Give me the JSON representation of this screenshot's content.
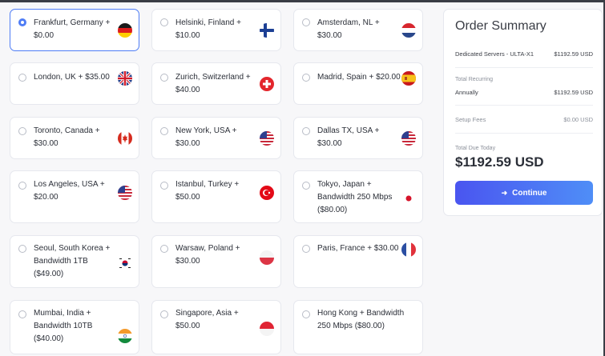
{
  "locations": [
    {
      "label": "Frankfurt, Germany +\n$0.00",
      "flag": "germany-flag-icon",
      "selected": true
    },
    {
      "label": "Helsinki, Finland +\n$10.00",
      "flag": "finland-flag-icon",
      "selected": false
    },
    {
      "label": "Amsterdam, NL +\n$30.00",
      "flag": "netherlands-flag-icon",
      "selected": false
    },
    {
      "label": "London, UK + $35.00",
      "flag": "uk-flag-icon",
      "selected": false
    },
    {
      "label": "Zurich, Switzerland +\n$40.00",
      "flag": "switzerland-flag-icon",
      "selected": false
    },
    {
      "label": "Madrid, Spain + $20.00",
      "flag": "spain-flag-icon",
      "selected": false
    },
    {
      "label": "Toronto, Canada +\n$30.00",
      "flag": "canada-flag-icon",
      "selected": false
    },
    {
      "label": "New York, USA +\n$30.00",
      "flag": "usa-flag-icon",
      "selected": false
    },
    {
      "label": "Dallas TX, USA +\n$30.00",
      "flag": "usa-flag-icon",
      "selected": false
    },
    {
      "label": "Los Angeles, USA +\n$20.00",
      "flag": "usa-flag-icon",
      "selected": false
    },
    {
      "label": "Istanbul, Turkey +\n$50.00",
      "flag": "turkey-flag-icon",
      "selected": false
    },
    {
      "label": "Tokyo, Japan +\nBandwidth 250 Mbps\n($80.00)",
      "flag": "japan-flag-icon",
      "selected": false
    },
    {
      "label": "Seoul, South Korea +\nBandwidth 1TB\n($49.00)",
      "flag": "south-korea-flag-icon",
      "selected": false
    },
    {
      "label": "Warsaw, Poland +\n$30.00",
      "flag": "poland-flag-icon",
      "selected": false
    },
    {
      "label": "Paris, France + $30.00",
      "flag": "france-flag-icon",
      "selected": false
    },
    {
      "label": "Mumbai, India +\nBandwidth 10TB\n($40.00)",
      "flag": "india-flag-icon",
      "selected": false
    },
    {
      "label": "Singapore, Asia +\n$50.00",
      "flag": "singapore-flag-icon",
      "selected": false
    },
    {
      "label": "Hong Kong + Bandwidth\n250 Mbps ($80.00)",
      "flag": "hong-kong-flag-icon",
      "selected": false
    }
  ],
  "summary": {
    "title": "Order Summary",
    "product_name": "Dedicated Servers - ULTA-X1",
    "product_price": "$1192.59 USD",
    "recurring_label": "Total Recurring",
    "annually_label": "Annually",
    "annually_price": "$1192.59 USD",
    "setup_label": "Setup Fees",
    "setup_price": "$0.00 USD",
    "due_label": "Total Due Today",
    "due_value": "$1192.59 USD",
    "continue_label": "Continue"
  },
  "colors": {
    "accent": "#4f7df5",
    "button_gradient_start": "#4a55f0",
    "button_gradient_end": "#4f8ef7"
  }
}
